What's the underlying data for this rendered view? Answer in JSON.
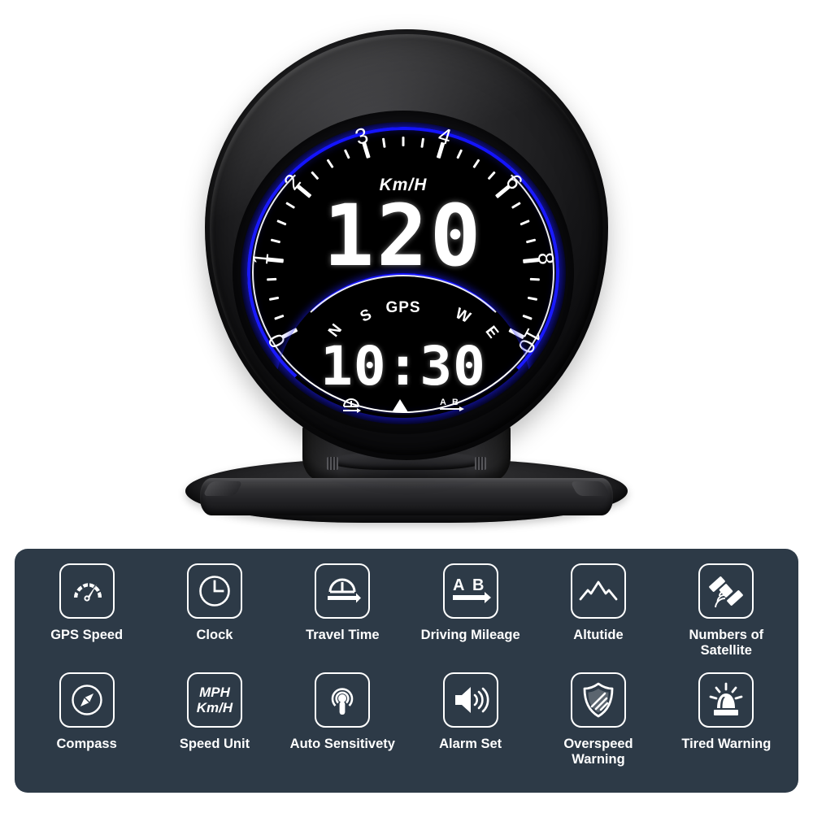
{
  "product": {
    "device_name": "gps-hud-head-up-display",
    "display": {
      "speed_unit": "Km/H",
      "speed_value": "120",
      "gps_label": "GPS",
      "clock_value": "10:30",
      "compass_letters": [
        "N",
        "S",
        "W",
        "E"
      ],
      "dial_numbers": [
        "0",
        "1",
        "2",
        "3",
        "4",
        "6",
        "8",
        "10"
      ],
      "status_icons": [
        "travel-time-icon",
        "altitude-icon",
        "ab-mileage-icon"
      ],
      "accent_color": "#1414ff",
      "screen_color": "#000000",
      "text_color": "#ffffff"
    }
  },
  "feature_panel": {
    "background_color": "#2d3a47",
    "features": [
      {
        "label": "GPS Speed",
        "icon": "speedometer-icon"
      },
      {
        "label": "Clock",
        "icon": "clock-icon"
      },
      {
        "label": "Travel Time",
        "icon": "travel-time-icon"
      },
      {
        "label": "Driving Mileage",
        "icon": "ab-mileage-icon"
      },
      {
        "label": "Altutide",
        "icon": "mountain-icon"
      },
      {
        "label": "Numbers of Satellite",
        "icon": "satellite-icon"
      },
      {
        "label": "Compass",
        "icon": "compass-icon"
      },
      {
        "label": "Speed Unit",
        "icon": "speed-unit-icon",
        "text_line1": "MPH",
        "text_line2": "Km/H"
      },
      {
        "label": "Auto Sensitivety",
        "icon": "sensor-wave-icon"
      },
      {
        "label": "Alarm Set",
        "icon": "speaker-icon"
      },
      {
        "label": "Overspeed Warning",
        "icon": "shield-icon"
      },
      {
        "label": "Tired Warning",
        "icon": "siren-icon"
      }
    ]
  }
}
